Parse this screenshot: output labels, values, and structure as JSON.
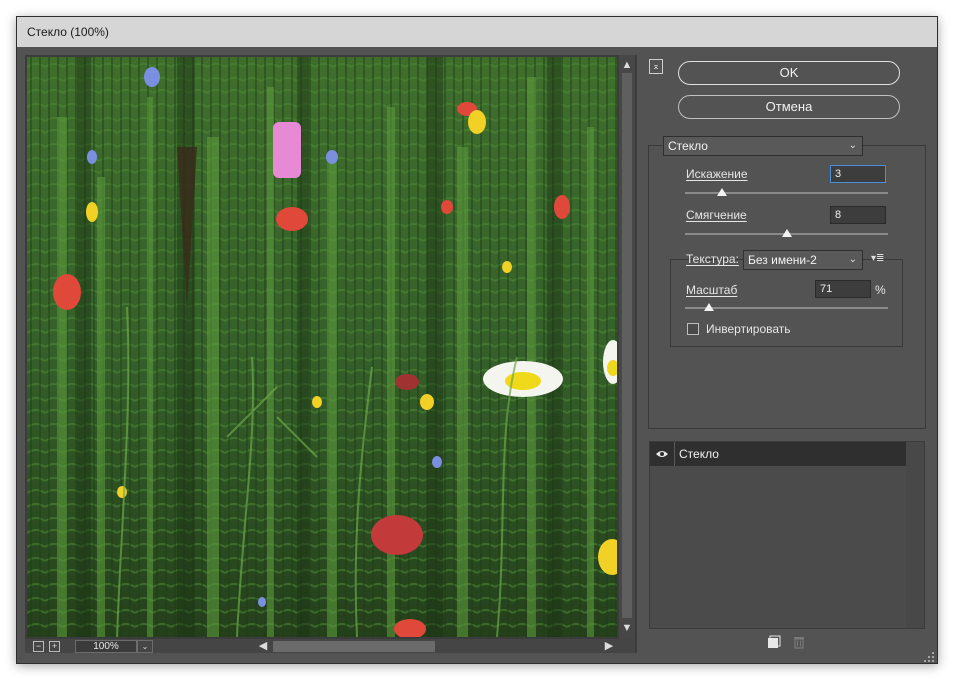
{
  "window": {
    "title": "Стекло (100%)"
  },
  "preview": {
    "image_alt": "Distorted wildflower meadow preview",
    "zoom": "100%",
    "zoom_minus_icon": "minus-square-icon",
    "zoom_plus_icon": "plus-square-icon"
  },
  "buttons": {
    "ok": "OK",
    "cancel": "Отмена"
  },
  "filter": {
    "selected": "Стекло",
    "distortion": {
      "label": "Искажение",
      "value": "3",
      "level": 0.18
    },
    "smoothness": {
      "label": "Смягчение",
      "value": "8",
      "level": 0.5
    },
    "texture": {
      "label": "Текстура:",
      "selected": "Без имени-2"
    },
    "scale": {
      "label": "Масштаб",
      "value": "71",
      "unit": "%",
      "level": 0.12
    },
    "invert": {
      "label": "Инвертировать",
      "checked": false
    }
  },
  "layers": [
    {
      "name": "Стекло",
      "visible": true
    }
  ],
  "colors": {
    "panel_bg": "#535353",
    "accent_focus": "#4b8fdc"
  }
}
